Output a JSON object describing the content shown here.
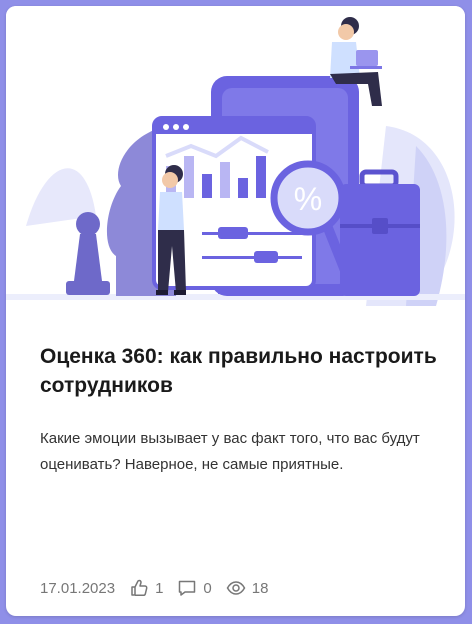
{
  "article": {
    "title": "Оценка 360: как правильно настроить сотрудников",
    "excerpt": "Какие эмоции вызывает у вас факт того, что вас будут оценивать? Наверное, не самые приятные.",
    "date": "17.01.2023",
    "likes": "1",
    "comments": "0",
    "views": "18",
    "illustration_icon": "assessment-illustration",
    "percent_symbol": "%"
  },
  "colors": {
    "accent": "#6b63e0",
    "accent_light": "#d9dbfa",
    "text_dark": "#1a1a1a",
    "meta": "#777777"
  }
}
